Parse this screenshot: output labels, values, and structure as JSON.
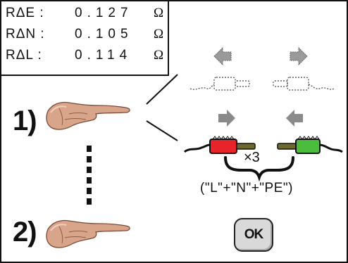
{
  "readings": [
    {
      "label": "RΔE :",
      "value": "0.127",
      "unit": "Ω"
    },
    {
      "label": "RΔN :",
      "value": "0.105",
      "unit": "Ω"
    },
    {
      "label": "RΔL :",
      "value": "0.114",
      "unit": "Ω"
    }
  ],
  "steps": {
    "step1": "1)",
    "step2": "2)"
  },
  "repeat_label": "×3",
  "combination_label": "(\"L\"+\"N\"+\"PE\")",
  "ok_button": {
    "label": "OK"
  },
  "colors": {
    "red_clip": "#e8232a",
    "green_clip": "#4cbc3c",
    "arrow_gray": "#8a8a8a"
  }
}
